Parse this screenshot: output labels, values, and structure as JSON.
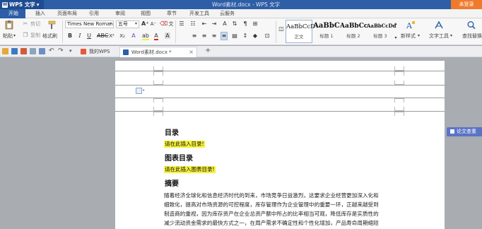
{
  "titlebar": {
    "app_name": "WPS 文字",
    "doc_title": "Word素材.docx - WPS 文字",
    "login_label": "未登录"
  },
  "menu": {
    "tabs": [
      "开始",
      "插入",
      "页面布局",
      "引用",
      "审阅",
      "视图",
      "章节",
      "开发工具",
      "云服务"
    ]
  },
  "ribbon": {
    "paste_label": "粘贴",
    "cut_label": "剪切",
    "copy_label": "复制",
    "format_painter_label": "格式刷",
    "font_name": "Times New Roman",
    "font_size": "五号",
    "styles": [
      {
        "preview": "AaBbCcD",
        "name": "正文"
      },
      {
        "preview": "AaBbC",
        "name": "标题 1"
      },
      {
        "preview": "AaBbCc",
        "name": "标题 2"
      },
      {
        "preview": "AaBbCcDd",
        "name": "标题 3"
      }
    ],
    "new_style_label": "新样式",
    "text_tools_label": "文字工具",
    "find_replace_label": "查找替换"
  },
  "tabsbar": {
    "tabs": [
      {
        "label": "我的WPS"
      },
      {
        "label": "Word素材.docx *"
      }
    ],
    "add_label": "+"
  },
  "document": {
    "heading_toc": "目录",
    "toc_placeholder": "请在此插入目录!",
    "heading_figures": "图表目录",
    "figures_placeholder": "请在此插入图表目录!",
    "heading_abstract": "摘要",
    "abstract_lines": [
      "随着经济全球化和信息经济时代的到来，市场竞争日益激烈，这要求企业经营更加深入化和",
      "细致化，提高对市场资源的可控程度，库存管理作为企业管理中的重要一环，正越来越受到",
      "制造商的重视，因为库存资产在企业总资产额中所占的比率相当可观，降低库存是实质性的",
      "减少流动资金需求的最快方式之一，在周产需求不确定性和个性化增加，产品寿命周期缩短"
    ]
  },
  "side_panel": {
    "paper_check_label": "论文查重"
  },
  "colors": {
    "title_blue": "#2d5ea6",
    "login_orange": "#f07a2c",
    "highlight_yellow": "#f6f23c",
    "side_button": "#5b74c7"
  }
}
